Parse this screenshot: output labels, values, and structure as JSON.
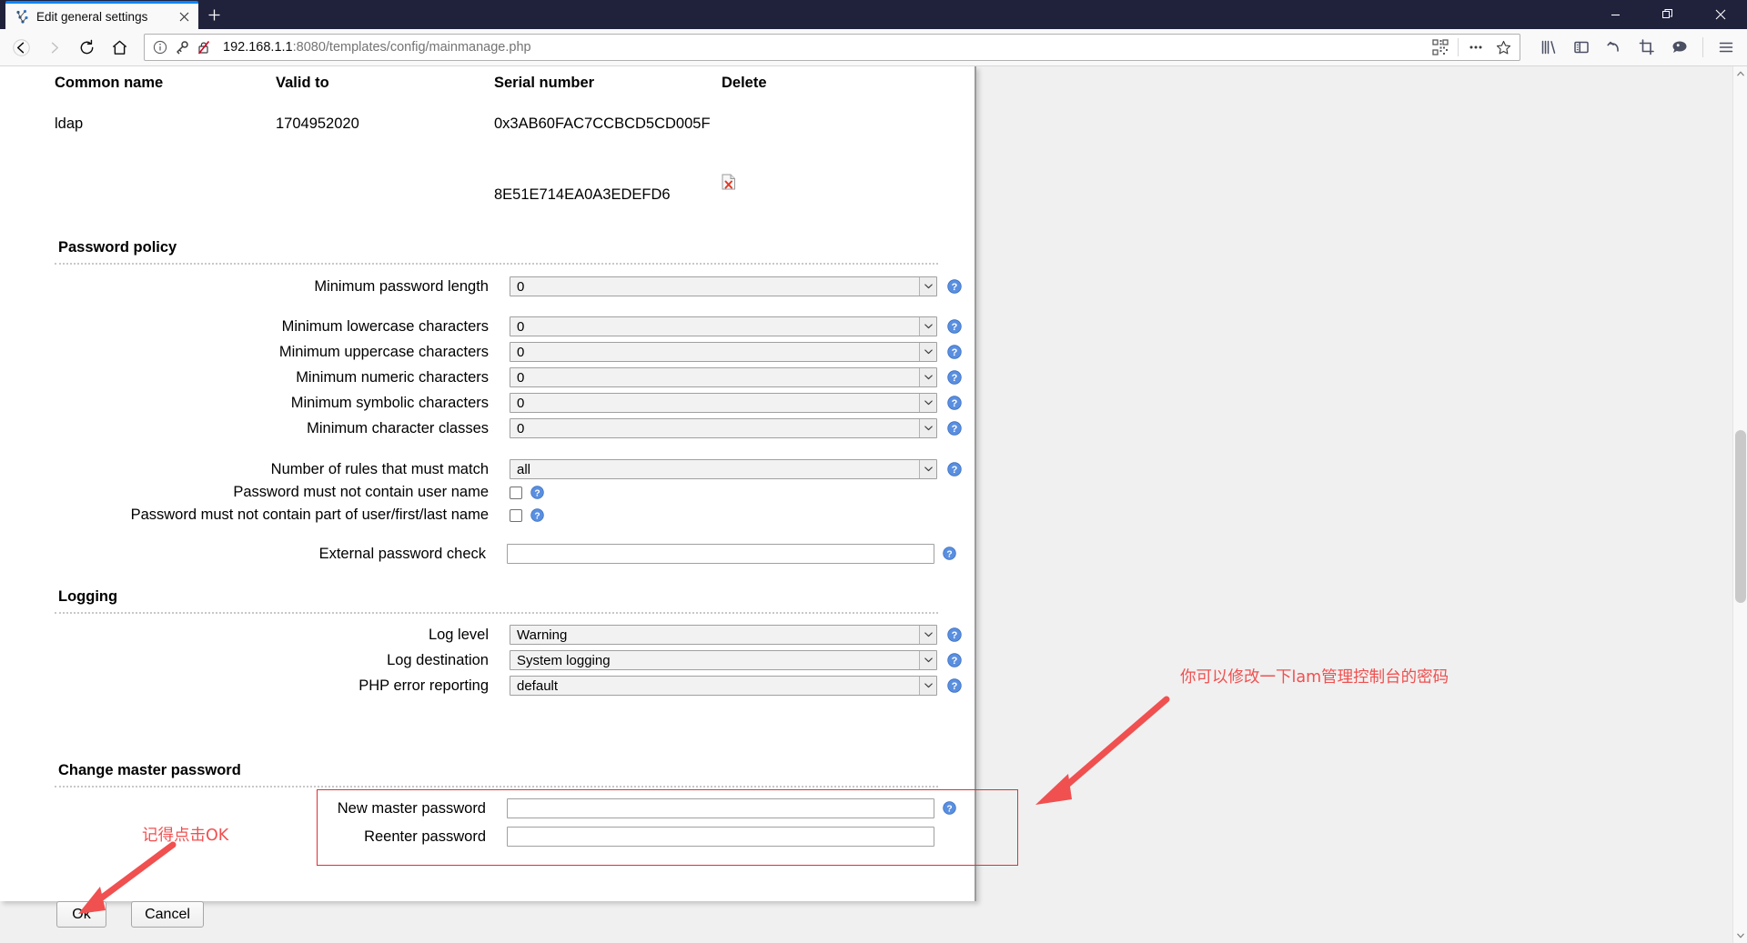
{
  "browser": {
    "tab": {
      "title": "Edit general settings",
      "favicon": "tree-icon",
      "close": "×"
    },
    "newtab_label": "+",
    "window_controls": {
      "minimize": "minimize-icon",
      "restore": "restore-icon",
      "close": "close-icon"
    },
    "nav": {
      "back": "back-arrow-icon",
      "forward": "forward-arrow-icon",
      "reload": "reload-icon",
      "home": "home-icon"
    },
    "url": {
      "host": "192.168.1.1",
      "path": ":8080/templates/config/mainmanage.php",
      "full": "192.168.1.1:8080/templates/config/mainmanage.php",
      "identity_icon": "info-circle-icon",
      "key_icon": "key-icon",
      "insecure_icon": "broken-lock-icon",
      "qr_icon": "qr-code-icon",
      "more_icon": "ellipsis-icon",
      "bookmark_icon": "star-icon"
    },
    "toolbar": {
      "library": "library-icon",
      "sidebar": "sidebar-icon",
      "undo": "undo-arrow-icon",
      "screenshot": "crop-icon",
      "chat": "chat-bubble-icon",
      "menu": "hamburger-menu-icon"
    }
  },
  "page": {
    "certificates": {
      "headers": [
        "Common name",
        "Valid to",
        "Serial number",
        "Delete"
      ],
      "rows": [
        {
          "common_name": "ldap",
          "valid_to": "1704952020",
          "serial_line1": "0x3AB60FAC7CCBCD5CD005F",
          "serial_line2": "8E51E714EA0A3EDEFD6",
          "delete_icon": "delete-file-icon"
        }
      ]
    },
    "password_policy": {
      "title": "Password policy",
      "fields": [
        {
          "label": "Minimum password length",
          "value": "0",
          "type": "select",
          "help": "help-icon"
        },
        {
          "label": "Minimum lowercase characters",
          "value": "0",
          "type": "select",
          "help": "help-icon"
        },
        {
          "label": "Minimum uppercase characters",
          "value": "0",
          "type": "select",
          "help": "help-icon"
        },
        {
          "label": "Minimum numeric characters",
          "value": "0",
          "type": "select",
          "help": "help-icon"
        },
        {
          "label": "Minimum symbolic characters",
          "value": "0",
          "type": "select",
          "help": "help-icon"
        },
        {
          "label": "Minimum character classes",
          "value": "0",
          "type": "select",
          "help": "help-icon"
        },
        {
          "label": "Number of rules that must match",
          "value": "all",
          "type": "select",
          "help": "help-icon"
        },
        {
          "label": "Password must not contain user name",
          "value": "",
          "type": "checkbox",
          "checked": false,
          "help": "help-icon"
        },
        {
          "label": "Password must not contain part of user/first/last name",
          "value": "",
          "type": "checkbox",
          "checked": false,
          "help": "help-icon"
        },
        {
          "label": "External password check",
          "value": "",
          "type": "text",
          "help": "help-icon"
        }
      ]
    },
    "logging": {
      "title": "Logging",
      "fields": [
        {
          "label": "Log level",
          "value": "Warning",
          "type": "select",
          "help": "help-icon"
        },
        {
          "label": "Log destination",
          "value": "System logging",
          "type": "select",
          "help": "help-icon"
        },
        {
          "label": "PHP error reporting",
          "value": "default",
          "type": "select",
          "help": "help-icon"
        }
      ]
    },
    "master_password": {
      "title": "Change master password",
      "fields": [
        {
          "label": "New master password",
          "value": "",
          "type": "password",
          "help": "help-icon"
        },
        {
          "label": "Reenter password",
          "value": "",
          "type": "password",
          "help": ""
        }
      ]
    },
    "buttons": {
      "ok": "Ok",
      "cancel": "Cancel"
    }
  },
  "annotations": {
    "ok_note": "记得点击OK",
    "password_note": "你可以修改一下lam管理控制台的密码",
    "color": "#f05050"
  },
  "colors": {
    "chrome_dark": "#20223c",
    "tab_active_accent": "#0a84ff",
    "toolbar_bg": "#f9f9fa",
    "page_bg": "#f0f0f0",
    "annotation_red": "#f05050",
    "highlight_box": "#e03030"
  }
}
